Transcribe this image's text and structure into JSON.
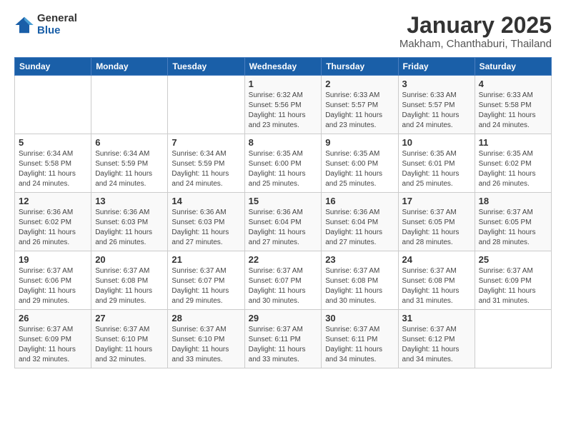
{
  "header": {
    "logo_general": "General",
    "logo_blue": "Blue",
    "main_title": "January 2025",
    "subtitle": "Makham, Chanthaburi, Thailand"
  },
  "days_of_week": [
    "Sunday",
    "Monday",
    "Tuesday",
    "Wednesday",
    "Thursday",
    "Friday",
    "Saturday"
  ],
  "weeks": [
    [
      {
        "date": "",
        "sunrise": "",
        "sunset": "",
        "daylight": ""
      },
      {
        "date": "",
        "sunrise": "",
        "sunset": "",
        "daylight": ""
      },
      {
        "date": "",
        "sunrise": "",
        "sunset": "",
        "daylight": ""
      },
      {
        "date": "1",
        "sunrise": "6:32 AM",
        "sunset": "5:56 PM",
        "daylight": "11 hours and 23 minutes."
      },
      {
        "date": "2",
        "sunrise": "6:33 AM",
        "sunset": "5:57 PM",
        "daylight": "11 hours and 23 minutes."
      },
      {
        "date": "3",
        "sunrise": "6:33 AM",
        "sunset": "5:57 PM",
        "daylight": "11 hours and 24 minutes."
      },
      {
        "date": "4",
        "sunrise": "6:33 AM",
        "sunset": "5:58 PM",
        "daylight": "11 hours and 24 minutes."
      }
    ],
    [
      {
        "date": "5",
        "sunrise": "6:34 AM",
        "sunset": "5:58 PM",
        "daylight": "11 hours and 24 minutes."
      },
      {
        "date": "6",
        "sunrise": "6:34 AM",
        "sunset": "5:59 PM",
        "daylight": "11 hours and 24 minutes."
      },
      {
        "date": "7",
        "sunrise": "6:34 AM",
        "sunset": "5:59 PM",
        "daylight": "11 hours and 24 minutes."
      },
      {
        "date": "8",
        "sunrise": "6:35 AM",
        "sunset": "6:00 PM",
        "daylight": "11 hours and 25 minutes."
      },
      {
        "date": "9",
        "sunrise": "6:35 AM",
        "sunset": "6:00 PM",
        "daylight": "11 hours and 25 minutes."
      },
      {
        "date": "10",
        "sunrise": "6:35 AM",
        "sunset": "6:01 PM",
        "daylight": "11 hours and 25 minutes."
      },
      {
        "date": "11",
        "sunrise": "6:35 AM",
        "sunset": "6:02 PM",
        "daylight": "11 hours and 26 minutes."
      }
    ],
    [
      {
        "date": "12",
        "sunrise": "6:36 AM",
        "sunset": "6:02 PM",
        "daylight": "11 hours and 26 minutes."
      },
      {
        "date": "13",
        "sunrise": "6:36 AM",
        "sunset": "6:03 PM",
        "daylight": "11 hours and 26 minutes."
      },
      {
        "date": "14",
        "sunrise": "6:36 AM",
        "sunset": "6:03 PM",
        "daylight": "11 hours and 27 minutes."
      },
      {
        "date": "15",
        "sunrise": "6:36 AM",
        "sunset": "6:04 PM",
        "daylight": "11 hours and 27 minutes."
      },
      {
        "date": "16",
        "sunrise": "6:36 AM",
        "sunset": "6:04 PM",
        "daylight": "11 hours and 27 minutes."
      },
      {
        "date": "17",
        "sunrise": "6:37 AM",
        "sunset": "6:05 PM",
        "daylight": "11 hours and 28 minutes."
      },
      {
        "date": "18",
        "sunrise": "6:37 AM",
        "sunset": "6:05 PM",
        "daylight": "11 hours and 28 minutes."
      }
    ],
    [
      {
        "date": "19",
        "sunrise": "6:37 AM",
        "sunset": "6:06 PM",
        "daylight": "11 hours and 29 minutes."
      },
      {
        "date": "20",
        "sunrise": "6:37 AM",
        "sunset": "6:08 PM",
        "daylight": "11 hours and 29 minutes."
      },
      {
        "date": "21",
        "sunrise": "6:37 AM",
        "sunset": "6:07 PM",
        "daylight": "11 hours and 29 minutes."
      },
      {
        "date": "22",
        "sunrise": "6:37 AM",
        "sunset": "6:07 PM",
        "daylight": "11 hours and 30 minutes."
      },
      {
        "date": "23",
        "sunrise": "6:37 AM",
        "sunset": "6:08 PM",
        "daylight": "11 hours and 30 minutes."
      },
      {
        "date": "24",
        "sunrise": "6:37 AM",
        "sunset": "6:08 PM",
        "daylight": "11 hours and 31 minutes."
      },
      {
        "date": "25",
        "sunrise": "6:37 AM",
        "sunset": "6:09 PM",
        "daylight": "11 hours and 31 minutes."
      }
    ],
    [
      {
        "date": "26",
        "sunrise": "6:37 AM",
        "sunset": "6:09 PM",
        "daylight": "11 hours and 32 minutes."
      },
      {
        "date": "27",
        "sunrise": "6:37 AM",
        "sunset": "6:10 PM",
        "daylight": "11 hours and 32 minutes."
      },
      {
        "date": "28",
        "sunrise": "6:37 AM",
        "sunset": "6:10 PM",
        "daylight": "11 hours and 33 minutes."
      },
      {
        "date": "29",
        "sunrise": "6:37 AM",
        "sunset": "6:11 PM",
        "daylight": "11 hours and 33 minutes."
      },
      {
        "date": "30",
        "sunrise": "6:37 AM",
        "sunset": "6:11 PM",
        "daylight": "11 hours and 34 minutes."
      },
      {
        "date": "31",
        "sunrise": "6:37 AM",
        "sunset": "6:12 PM",
        "daylight": "11 hours and 34 minutes."
      },
      {
        "date": "",
        "sunrise": "",
        "sunset": "",
        "daylight": ""
      }
    ]
  ]
}
